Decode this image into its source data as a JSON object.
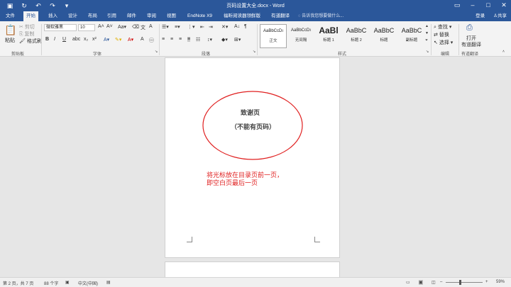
{
  "titlebar": {
    "title": "页码设置大全.docx - Word",
    "qat": [
      "save-icon",
      "refresh-icon",
      "undo-icon",
      "redo-icon",
      "customize-icon"
    ]
  },
  "tabs": [
    "文件",
    "开始",
    "插入",
    "设计",
    "布局",
    "引用",
    "邮件",
    "审阅",
    "视图",
    "EndNote X9",
    "福昕阅读器领鲜版",
    "有道翻译"
  ],
  "active_tab": "开始",
  "tell_me": "告诉我您想要做什么...",
  "account": {
    "login": "登录",
    "share": "共享"
  },
  "clipboard": {
    "paste": "粘贴",
    "cut": "剪切",
    "copy": "复制",
    "format_painter": "格式刷",
    "label": "剪贴板"
  },
  "font": {
    "name": "微软雅黑",
    "size": "10",
    "label": "字体"
  },
  "paragraph": {
    "label": "段落"
  },
  "styles": {
    "label": "样式",
    "items": [
      {
        "preview": "AaBbCcDı",
        "name": "正文"
      },
      {
        "preview": "AaBbCcDı",
        "name": "无间隔"
      },
      {
        "preview": "AaBl",
        "name": "标题 1"
      },
      {
        "preview": "AaBbC",
        "name": "标题 2"
      },
      {
        "preview": "AaBbC",
        "name": "标题"
      },
      {
        "preview": "AaBbC",
        "name": "副标题"
      }
    ]
  },
  "editing": {
    "find": "查找",
    "replace": "替换",
    "select": "选择",
    "label": "编辑"
  },
  "youdao": {
    "open": "打开",
    "open2": "有道翻译",
    "label": "有道翻译"
  },
  "document": {
    "ack_title": "致谢页",
    "ack_sub": "（不能有页码）",
    "note_line1": "将光标放在目录页前一页，",
    "note_line2": "即空白页最后一页",
    "accent_red": "#e02020"
  },
  "status": {
    "page": "第 2 页，共 7 页",
    "words": "88 个字",
    "lang": "中文(中国)",
    "zoom": "59%"
  }
}
